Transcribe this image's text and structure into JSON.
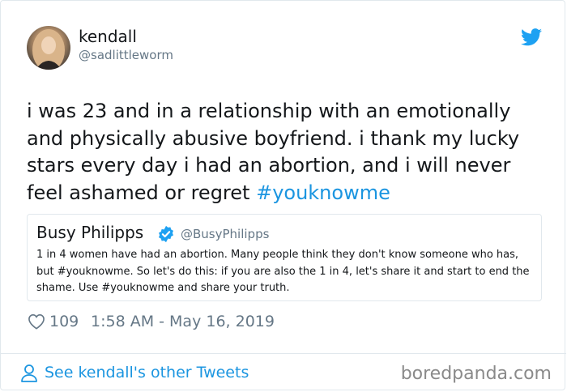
{
  "colors": {
    "twitter_blue": "#1da1f2",
    "link_blue": "#1b95e0",
    "secondary_text": "#657786",
    "border": "#e1e8ed"
  },
  "author": {
    "display_name": "kendall",
    "handle": "@sadlittleworm"
  },
  "tweet": {
    "text": "i was 23 and in a relationship with an emotionally and physically abusive boyfriend. i thank my lucky stars every day i had an abortion, and i will never feel ashamed or regret ",
    "hashtag": "#youknowme",
    "like_count": "109",
    "timestamp": "1:58 AM - May 16, 2019"
  },
  "quoted_tweet": {
    "display_name": "Busy Philipps",
    "handle": "@BusyPhilipps",
    "text": "1 in 4 women have had an abortion. Many people think they don't know someone who has, but #youknowme. So let's do this: if you are also the 1 in 4, let's share it and start to end the shame. Use #youknowme and share your truth."
  },
  "footer": {
    "see_more_label": "See kendall's other Tweets",
    "watermark": "boredpanda.com"
  },
  "icons": {
    "brand": "twitter-bird-icon",
    "verified": "verified-badge-icon",
    "like": "heart-icon",
    "person": "person-icon"
  }
}
